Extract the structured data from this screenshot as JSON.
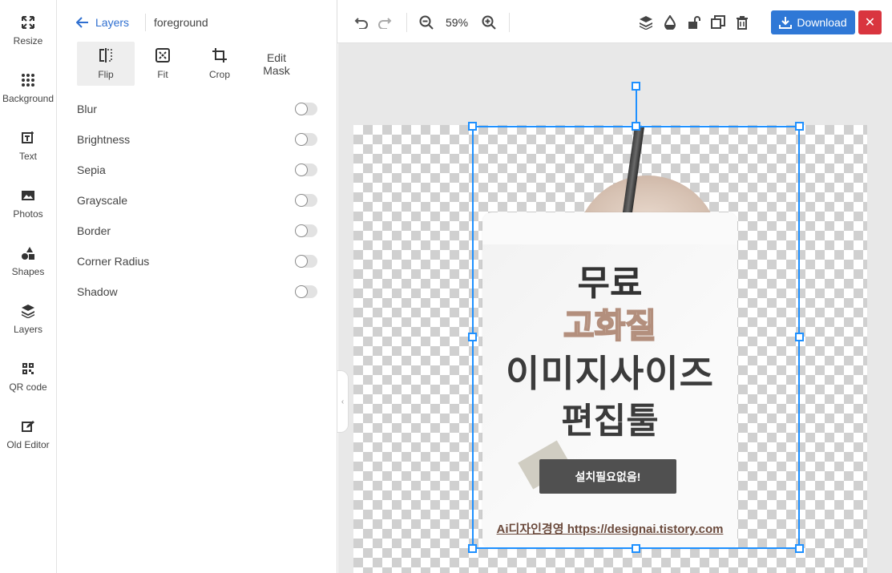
{
  "rail": {
    "items": [
      {
        "label": "Resize",
        "icon": "resize-icon"
      },
      {
        "label": "Background",
        "icon": "grid-dots-icon"
      },
      {
        "label": "Text",
        "icon": "text-icon"
      },
      {
        "label": "Photos",
        "icon": "image-icon"
      },
      {
        "label": "Shapes",
        "icon": "shapes-icon"
      },
      {
        "label": "Layers",
        "icon": "layers-icon"
      },
      {
        "label": "QR code",
        "icon": "qr-code-icon"
      },
      {
        "label": "Old Editor",
        "icon": "edit-icon"
      }
    ]
  },
  "panel": {
    "back_label": "Layers",
    "layer_name": "foreground",
    "tools": [
      {
        "label": "Flip",
        "icon": "flip-icon",
        "active": true
      },
      {
        "label": "Fit",
        "icon": "fit-icon",
        "active": false
      },
      {
        "label": "Crop",
        "icon": "crop-icon",
        "active": false
      },
      {
        "label": "Edit\nMask",
        "icon": "",
        "active": false
      }
    ],
    "options": [
      {
        "label": "Blur",
        "on": false
      },
      {
        "label": "Brightness",
        "on": false
      },
      {
        "label": "Sepia",
        "on": false
      },
      {
        "label": "Grayscale",
        "on": false
      },
      {
        "label": "Border",
        "on": false
      },
      {
        "label": "Corner Radius",
        "on": false
      },
      {
        "label": "Shadow",
        "on": false
      }
    ]
  },
  "toolbar": {
    "zoom": "59%",
    "download_label": "Download",
    "close_symbol": "✕",
    "collapse_symbol": "‹"
  },
  "canvas": {
    "line1": "무료",
    "line2": "고화질",
    "line3": "이미지사이즈",
    "line4": "편집툴",
    "button": "설치필요없음!",
    "footer": "Ai디자인경영 https://designai.tistory.com"
  },
  "colors": {
    "accent": "#2f78d6",
    "selection": "#1e90ff",
    "close": "#d9353f"
  }
}
